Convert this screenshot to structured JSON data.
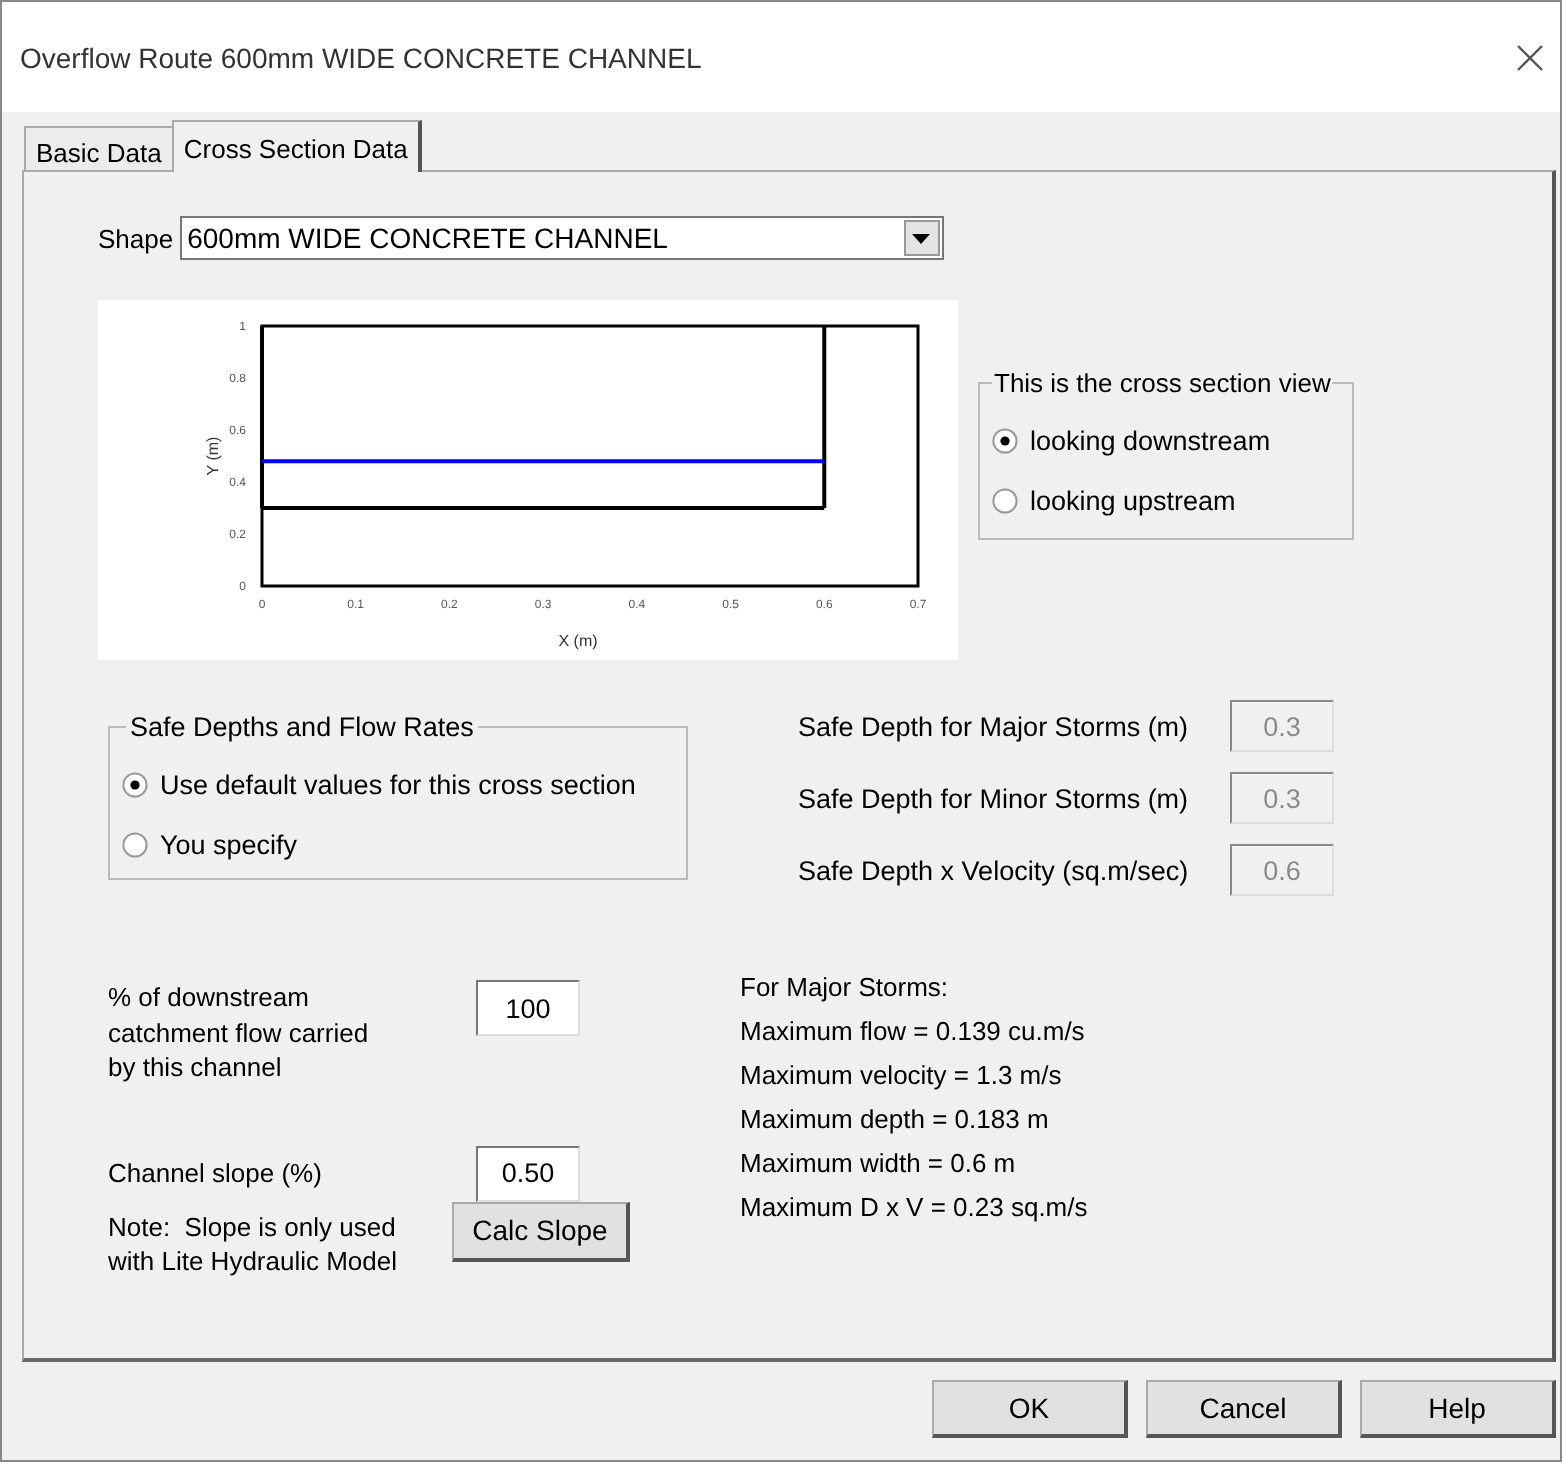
{
  "window": {
    "title": "Overflow Route 600mm WIDE CONCRETE CHANNEL"
  },
  "tabs": [
    {
      "label": "Basic Data",
      "selected": false
    },
    {
      "label": "Cross Section Data",
      "selected": true
    }
  ],
  "shape": {
    "label": "Shape",
    "value": "600mm WIDE CONCRETE CHANNEL"
  },
  "cross_section": {
    "chart_data": {
      "type": "line",
      "xlabel": "X (m)",
      "ylabel": "Y (m)",
      "x": [
        0,
        0.6
      ],
      "series": [
        {
          "color": "#000000",
          "values": [
            0.3,
            0.3
          ]
        },
        {
          "color": "#0000ff",
          "values": [
            0.48,
            0.48
          ]
        }
      ],
      "ref_lines": [
        {
          "axis": "x",
          "value": 0,
          "color": "#000000"
        },
        {
          "axis": "x",
          "value": 0.6,
          "color": "#000000"
        }
      ],
      "xlim": [
        0,
        0.7
      ],
      "ylim": [
        0,
        1
      ],
      "xticks": [
        0,
        0.1,
        0.2,
        0.3,
        0.4,
        0.5,
        0.6,
        0.7
      ],
      "yticks": [
        0,
        0.2,
        0.4,
        0.6,
        0.8,
        1
      ]
    }
  },
  "view_group": {
    "title": "This is the cross section view",
    "options": [
      {
        "label": "looking downstream",
        "selected": true
      },
      {
        "label": "looking upstream",
        "selected": false
      }
    ]
  },
  "safe_group": {
    "title": "Safe Depths and Flow Rates",
    "options": [
      {
        "label": "Use default values for this cross section",
        "selected": true
      },
      {
        "label": "You specify",
        "selected": false
      }
    ]
  },
  "safe_values": [
    {
      "label": "Safe Depth for Major Storms (m)",
      "value": "0.3",
      "disabled": true
    },
    {
      "label": "Safe Depth for Minor Storms (m)",
      "value": "0.3",
      "disabled": true
    },
    {
      "label": "Safe Depth x Velocity (sq.m/sec)",
      "value": "0.6",
      "disabled": true
    }
  ],
  "flow_share": {
    "label": "% of downstream\ncatchment flow carried\nby this channel",
    "value": "100"
  },
  "slope": {
    "label": "Channel slope (%)",
    "value": "0.50"
  },
  "note": "Note:  Slope is only used\nwith Lite Hydraulic Model",
  "calc_button": "Calc Slope",
  "results": {
    "heading": "For Major Storms:",
    "lines": [
      "Maximum flow = 0.139 cu.m/s",
      "Maximum velocity = 1.3 m/s",
      "Maximum depth = 0.183 m",
      "Maximum width = 0.6 m",
      "Maximum D x V = 0.23 sq.m/s"
    ]
  },
  "buttons": [
    "OK",
    "Cancel",
    "Help"
  ]
}
